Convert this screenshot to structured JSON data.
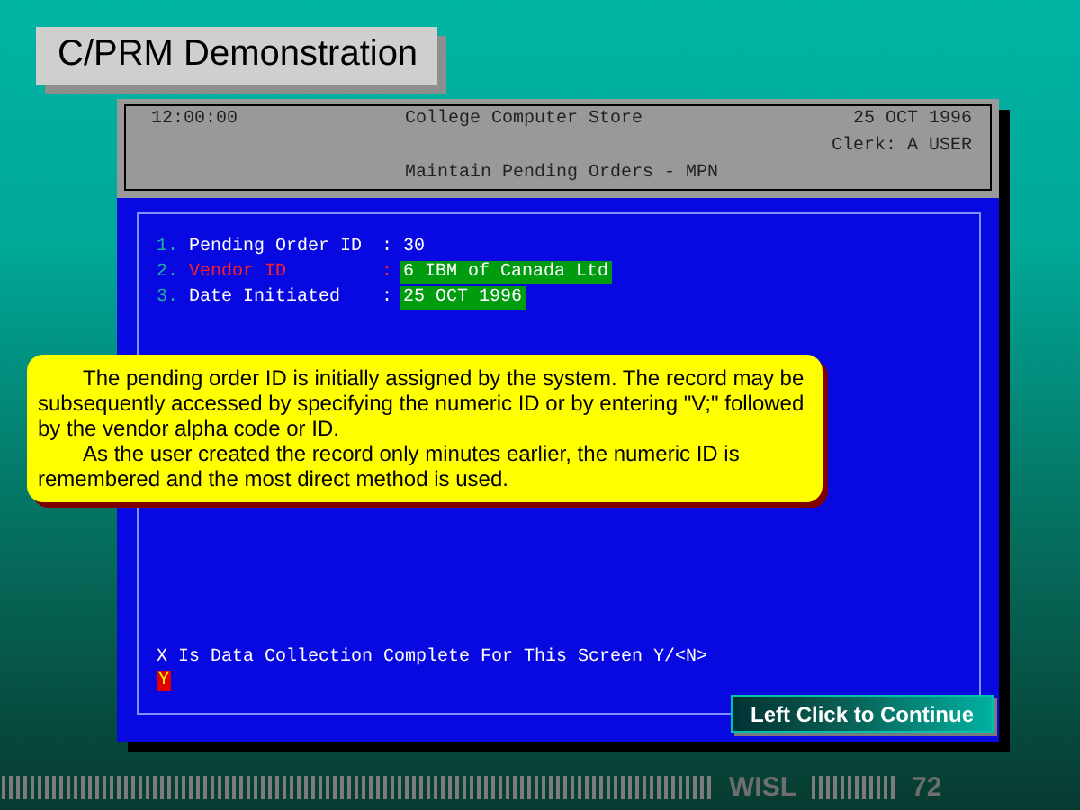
{
  "slide_title": "C/PRM Demonstration",
  "terminal": {
    "header": {
      "time": "12:00:00",
      "company": "College Computer Store",
      "date": "25 OCT 1996",
      "clerk": "Clerk: A USER",
      "screen_title": "Maintain Pending Orders - MPN"
    },
    "fields": [
      {
        "number": "1.",
        "label": "Pending Order ID",
        "separator": ":",
        "value": "30",
        "active": false,
        "highlighted": false
      },
      {
        "number": "2.",
        "label": "Vendor ID",
        "separator": ":",
        "value": "6 IBM of Canada Ltd",
        "active": true,
        "highlighted": true
      },
      {
        "number": "3.",
        "label": "Date Initiated",
        "separator": ":",
        "value": "25 OCT 1996",
        "active": false,
        "highlighted": true
      }
    ],
    "prompt": {
      "text": "X Is Data Collection Complete For This Screen Y/<N>",
      "input": "Y"
    }
  },
  "callout": {
    "paragraphs": [
      "The pending order ID is initially assigned by the system. The record may be subsequently accessed by specifying the numeric ID or by entering \"V;\" followed by the vendor alpha code or ID.",
      "As the user created the record only minutes earlier, the numeric ID is remembered and the most direct method is used."
    ]
  },
  "continue_button": "Left Click to Continue",
  "footer": {
    "brand": "WISL",
    "page": "72"
  }
}
